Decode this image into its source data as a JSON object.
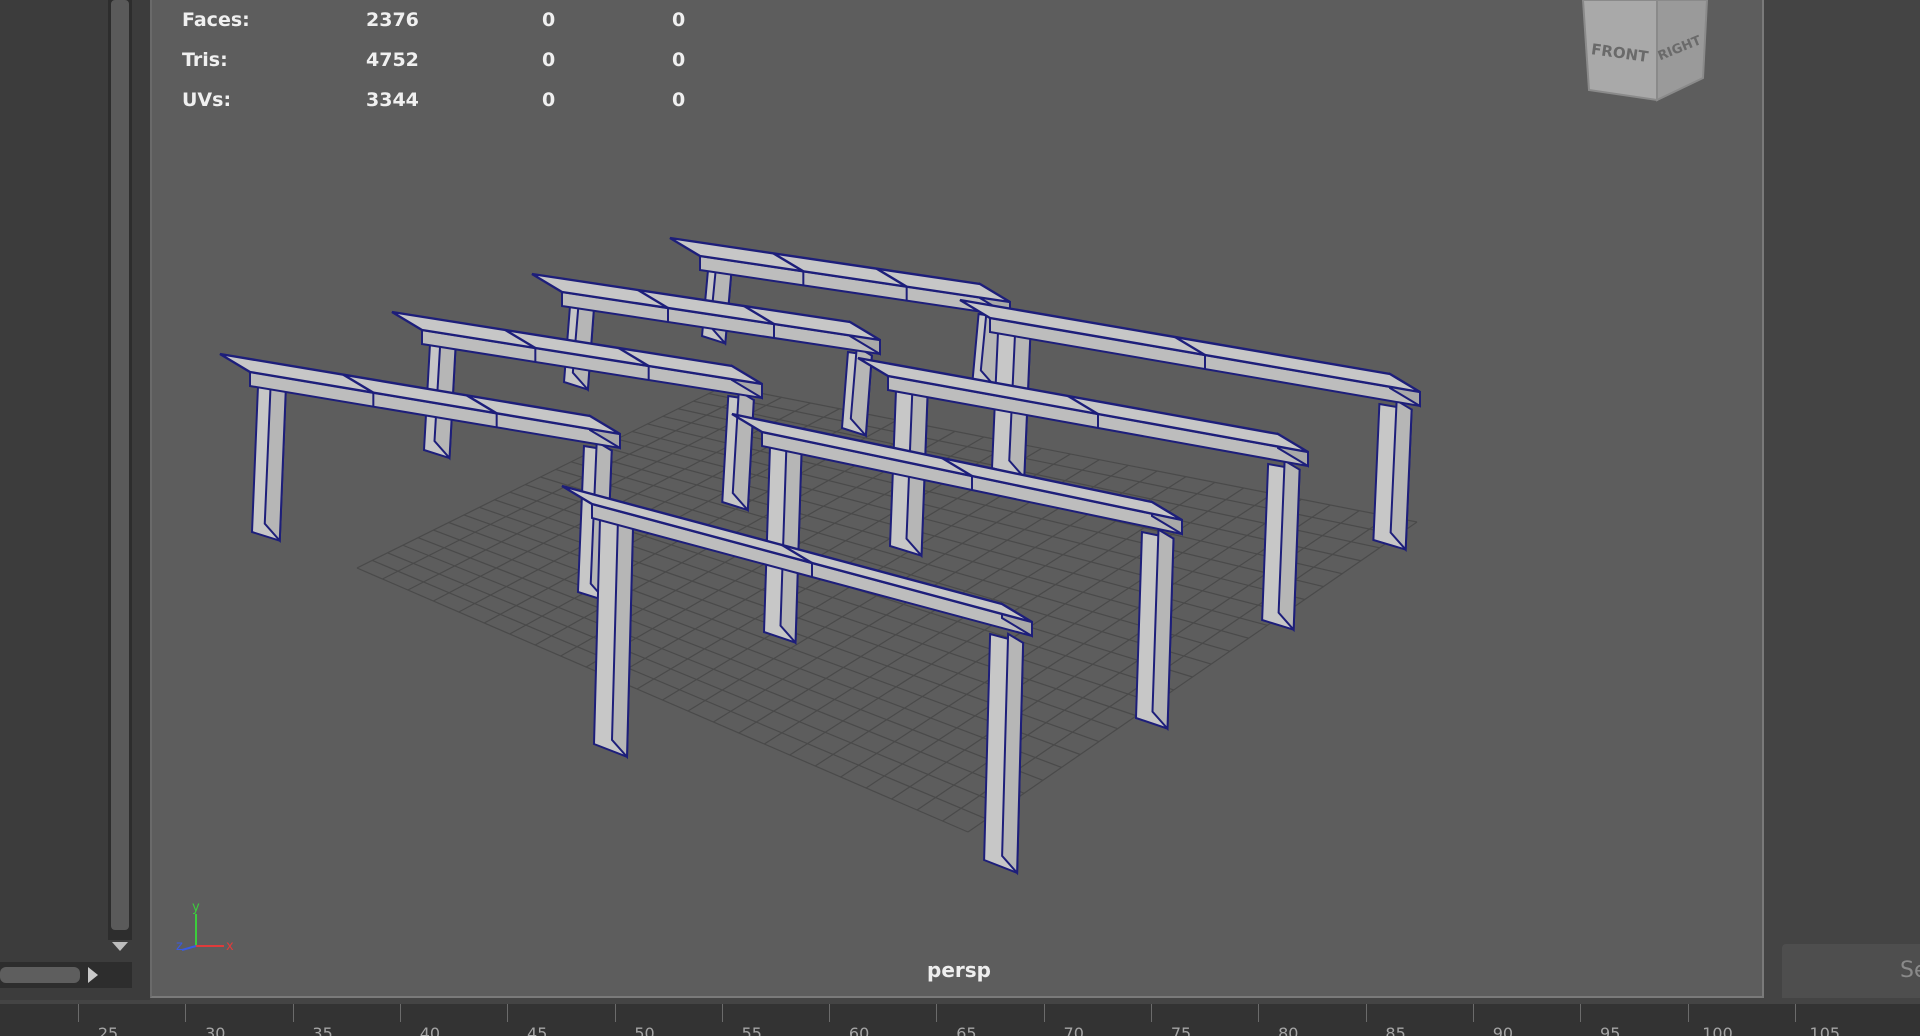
{
  "hud": {
    "rows": [
      {
        "label": "Faces:",
        "v1": "2376",
        "v2": "0",
        "v3": "0"
      },
      {
        "label": "Tris:",
        "v1": "4752",
        "v2": "0",
        "v3": "0"
      },
      {
        "label": "UVs:",
        "v1": "3344",
        "v2": "0",
        "v3": "0"
      }
    ]
  },
  "viewport": {
    "camera_label": "persp",
    "view_cube": {
      "front": "FRONT",
      "right": "RIGHT"
    },
    "axis": {
      "y": "y",
      "z": "z",
      "x": "x"
    }
  },
  "right_panel": {
    "field_text": "Se"
  },
  "timeline": {
    "ticks": [
      "25",
      "30",
      "35",
      "40",
      "45",
      "50",
      "55",
      "60",
      "65",
      "70",
      "75",
      "80",
      "85",
      "90",
      "95",
      "100",
      "105"
    ]
  },
  "colors": {
    "viewport_bg": "#5d5d5d",
    "wireframe": "#1d1e7a",
    "mesh_face": "#c7c7c7",
    "grid": "#4a4a4a"
  }
}
